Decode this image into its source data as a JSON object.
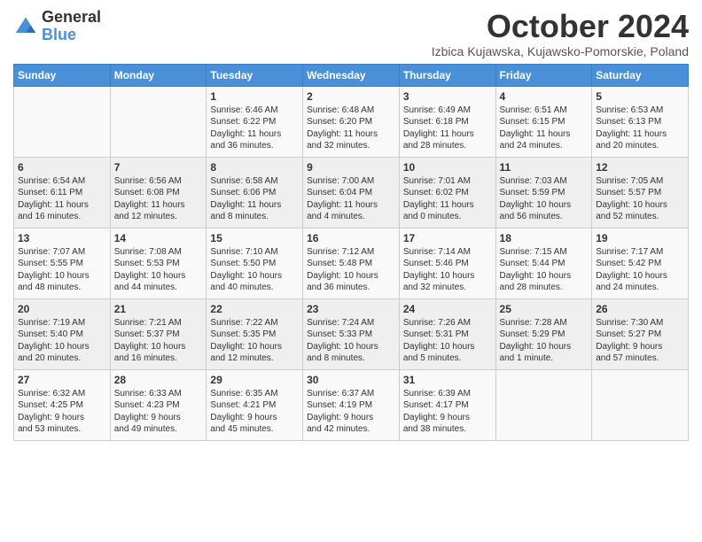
{
  "logo": {
    "general": "General",
    "blue": "Blue"
  },
  "title": {
    "month": "October 2024",
    "location": "Izbica Kujawska, Kujawsko-Pomorskie, Poland"
  },
  "headers": [
    "Sunday",
    "Monday",
    "Tuesday",
    "Wednesday",
    "Thursday",
    "Friday",
    "Saturday"
  ],
  "weeks": [
    [
      {
        "day": "",
        "info": ""
      },
      {
        "day": "",
        "info": ""
      },
      {
        "day": "1",
        "info": "Sunrise: 6:46 AM\nSunset: 6:22 PM\nDaylight: 11 hours\nand 36 minutes."
      },
      {
        "day": "2",
        "info": "Sunrise: 6:48 AM\nSunset: 6:20 PM\nDaylight: 11 hours\nand 32 minutes."
      },
      {
        "day": "3",
        "info": "Sunrise: 6:49 AM\nSunset: 6:18 PM\nDaylight: 11 hours\nand 28 minutes."
      },
      {
        "day": "4",
        "info": "Sunrise: 6:51 AM\nSunset: 6:15 PM\nDaylight: 11 hours\nand 24 minutes."
      },
      {
        "day": "5",
        "info": "Sunrise: 6:53 AM\nSunset: 6:13 PM\nDaylight: 11 hours\nand 20 minutes."
      }
    ],
    [
      {
        "day": "6",
        "info": "Sunrise: 6:54 AM\nSunset: 6:11 PM\nDaylight: 11 hours\nand 16 minutes."
      },
      {
        "day": "7",
        "info": "Sunrise: 6:56 AM\nSunset: 6:08 PM\nDaylight: 11 hours\nand 12 minutes."
      },
      {
        "day": "8",
        "info": "Sunrise: 6:58 AM\nSunset: 6:06 PM\nDaylight: 11 hours\nand 8 minutes."
      },
      {
        "day": "9",
        "info": "Sunrise: 7:00 AM\nSunset: 6:04 PM\nDaylight: 11 hours\nand 4 minutes."
      },
      {
        "day": "10",
        "info": "Sunrise: 7:01 AM\nSunset: 6:02 PM\nDaylight: 11 hours\nand 0 minutes."
      },
      {
        "day": "11",
        "info": "Sunrise: 7:03 AM\nSunset: 5:59 PM\nDaylight: 10 hours\nand 56 minutes."
      },
      {
        "day": "12",
        "info": "Sunrise: 7:05 AM\nSunset: 5:57 PM\nDaylight: 10 hours\nand 52 minutes."
      }
    ],
    [
      {
        "day": "13",
        "info": "Sunrise: 7:07 AM\nSunset: 5:55 PM\nDaylight: 10 hours\nand 48 minutes."
      },
      {
        "day": "14",
        "info": "Sunrise: 7:08 AM\nSunset: 5:53 PM\nDaylight: 10 hours\nand 44 minutes."
      },
      {
        "day": "15",
        "info": "Sunrise: 7:10 AM\nSunset: 5:50 PM\nDaylight: 10 hours\nand 40 minutes."
      },
      {
        "day": "16",
        "info": "Sunrise: 7:12 AM\nSunset: 5:48 PM\nDaylight: 10 hours\nand 36 minutes."
      },
      {
        "day": "17",
        "info": "Sunrise: 7:14 AM\nSunset: 5:46 PM\nDaylight: 10 hours\nand 32 minutes."
      },
      {
        "day": "18",
        "info": "Sunrise: 7:15 AM\nSunset: 5:44 PM\nDaylight: 10 hours\nand 28 minutes."
      },
      {
        "day": "19",
        "info": "Sunrise: 7:17 AM\nSunset: 5:42 PM\nDaylight: 10 hours\nand 24 minutes."
      }
    ],
    [
      {
        "day": "20",
        "info": "Sunrise: 7:19 AM\nSunset: 5:40 PM\nDaylight: 10 hours\nand 20 minutes."
      },
      {
        "day": "21",
        "info": "Sunrise: 7:21 AM\nSunset: 5:37 PM\nDaylight: 10 hours\nand 16 minutes."
      },
      {
        "day": "22",
        "info": "Sunrise: 7:22 AM\nSunset: 5:35 PM\nDaylight: 10 hours\nand 12 minutes."
      },
      {
        "day": "23",
        "info": "Sunrise: 7:24 AM\nSunset: 5:33 PM\nDaylight: 10 hours\nand 8 minutes."
      },
      {
        "day": "24",
        "info": "Sunrise: 7:26 AM\nSunset: 5:31 PM\nDaylight: 10 hours\nand 5 minutes."
      },
      {
        "day": "25",
        "info": "Sunrise: 7:28 AM\nSunset: 5:29 PM\nDaylight: 10 hours\nand 1 minute."
      },
      {
        "day": "26",
        "info": "Sunrise: 7:30 AM\nSunset: 5:27 PM\nDaylight: 9 hours\nand 57 minutes."
      }
    ],
    [
      {
        "day": "27",
        "info": "Sunrise: 6:32 AM\nSunset: 4:25 PM\nDaylight: 9 hours\nand 53 minutes."
      },
      {
        "day": "28",
        "info": "Sunrise: 6:33 AM\nSunset: 4:23 PM\nDaylight: 9 hours\nand 49 minutes."
      },
      {
        "day": "29",
        "info": "Sunrise: 6:35 AM\nSunset: 4:21 PM\nDaylight: 9 hours\nand 45 minutes."
      },
      {
        "day": "30",
        "info": "Sunrise: 6:37 AM\nSunset: 4:19 PM\nDaylight: 9 hours\nand 42 minutes."
      },
      {
        "day": "31",
        "info": "Sunrise: 6:39 AM\nSunset: 4:17 PM\nDaylight: 9 hours\nand 38 minutes."
      },
      {
        "day": "",
        "info": ""
      },
      {
        "day": "",
        "info": ""
      }
    ]
  ]
}
